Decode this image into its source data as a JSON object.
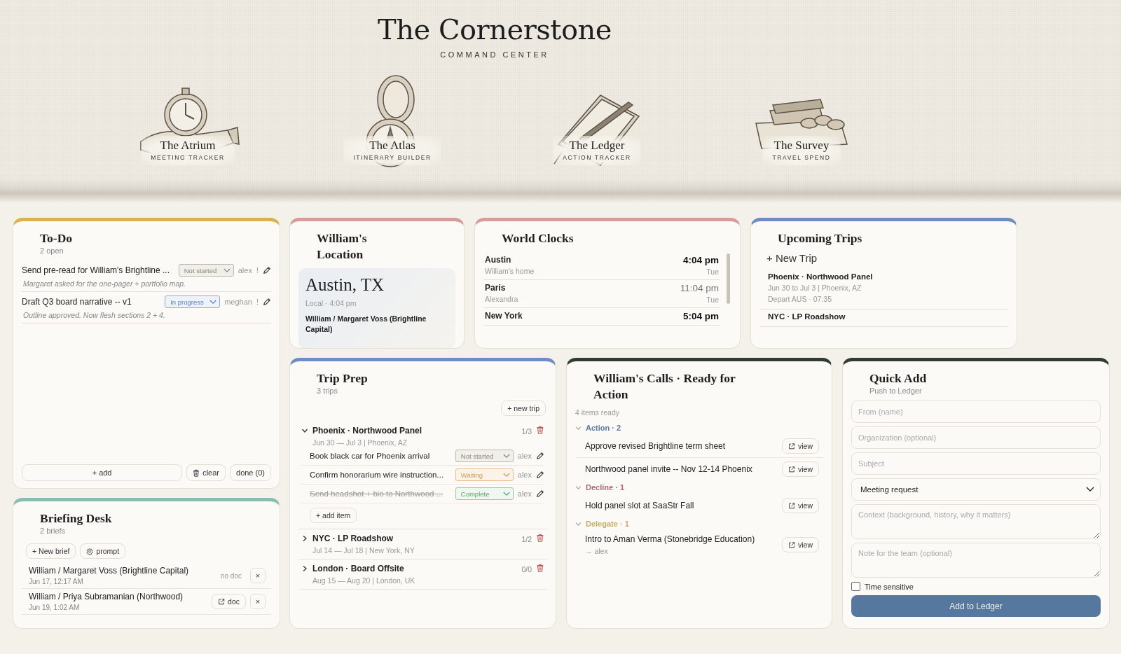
{
  "header": {
    "title": "The Cornerstone",
    "subtitle": "COMMAND CENTER"
  },
  "nav": [
    {
      "kind": "watch",
      "title": "The Atrium",
      "subtitle": "MEETING TRACKER"
    },
    {
      "kind": "compass",
      "title": "The Atlas",
      "subtitle": "ITINERARY BUILDER"
    },
    {
      "kind": "ledger",
      "title": "The Ledger",
      "subtitle": "ACTION TRACKER"
    },
    {
      "kind": "money",
      "title": "The Survey",
      "subtitle": "TRAVEL SPEND"
    }
  ],
  "todo": {
    "title": "To-Do",
    "count": "2 open",
    "items": [
      {
        "text": "Send pre-read for William's Brightline ...",
        "status": {
          "label": "Not started",
          "kind": "neutral"
        },
        "owner": "alex",
        "flag": "!",
        "note": "Margaret asked for the one-pager + portfolio map."
      },
      {
        "text": "Draft Q3 board narrative -- v1",
        "status": {
          "label": "In progress",
          "kind": "progress"
        },
        "owner": "meghan",
        "flag": "!",
        "note": "Outline approved. Now flesh sections 2 + 4."
      }
    ],
    "add": "+ add",
    "clear": "clear",
    "done": "done (0)"
  },
  "briefing": {
    "title": "Briefing Desk",
    "count": "2 briefs",
    "new": "+ New brief",
    "prompt": "prompt",
    "items": [
      {
        "title": "William / Margaret Voss (Brightline Capital)",
        "time": "Jun 17, 12:17 AM",
        "doc": {
          "kind": "none",
          "label": "no doc"
        },
        "close": "×"
      },
      {
        "title": "William / Priya Subramanian (Northwood)",
        "time": "Jun 19, 1:02 AM",
        "doc": {
          "kind": "link",
          "label": "doc"
        },
        "close": "×"
      }
    ]
  },
  "location": {
    "title": "William's Location",
    "city": "Austin, TX",
    "local": "Local · 4:04 pm",
    "meeting": "William / Margaret Voss (Brightline Capital)"
  },
  "clocks": {
    "title": "World Clocks",
    "items": [
      {
        "city": "Austin",
        "label": "William's home",
        "time": "4:04 pm",
        "day": "Tue",
        "dim": false
      },
      {
        "city": "Paris",
        "label": "Alexandra",
        "time": "11:04 pm",
        "day": "Tue",
        "dim": true
      },
      {
        "city": "New York",
        "time": "5:04 pm",
        "dim": false
      }
    ]
  },
  "trips": {
    "title": "Upcoming Trips",
    "new": "+ New Trip",
    "items": [
      {
        "name": "Phoenix · Northwood Panel",
        "dates": "Jun 30 to Jul 3 | Phoenix, AZ",
        "depart": "Depart AUS · 07:35"
      },
      {
        "name": "NYC · LP Roadshow"
      }
    ]
  },
  "trip_prep": {
    "title": "Trip Prep",
    "count": "3 trips",
    "new": "+ new trip",
    "add_item": "+ add item",
    "trips": [
      {
        "name": "Phoenix · Northwood Panel",
        "dates": "Jun 30 — Jul 3 | Phoenix, AZ",
        "progress": "1/3",
        "expanded": true,
        "items": [
          {
            "text": "Book black car for Phoenix arrival",
            "status": {
              "label": "Not started",
              "kind": "neutral"
            },
            "owner": "alex",
            "done": false
          },
          {
            "text": "Confirm honorarium wire instruction...",
            "status": {
              "label": "Waiting",
              "kind": "waiting"
            },
            "owner": "alex",
            "done": false
          },
          {
            "text": "Send headshot + bio to Northwood ...",
            "status": {
              "label": "Complete",
              "kind": "complete"
            },
            "owner": "alex",
            "done": true
          }
        ]
      },
      {
        "name": "NYC · LP Roadshow",
        "dates": "Jul 14 — Jul 18 | New York, NY",
        "progress": "1/2",
        "expanded": false
      },
      {
        "name": "London · Board Offsite",
        "dates": "Aug 15 — Aug 20 | London, UK",
        "progress": "0/0",
        "expanded": false
      }
    ]
  },
  "calls": {
    "title": "William's Calls · Ready for Action",
    "count": "4 items ready",
    "groups": [
      {
        "label": "Action · 2",
        "color": "#5b7aa6",
        "expanded": true,
        "items": [
          {
            "text": "Approve revised Brightline term sheet",
            "button": "view"
          },
          {
            "text": "Northwood panel invite -- Nov 12-14 Phoenix",
            "button": "view"
          }
        ]
      },
      {
        "label": "Decline · 1",
        "color": "#b5647a",
        "expanded": true,
        "items": [
          {
            "text": "Hold panel slot at SaaStr Fall",
            "button": "view"
          }
        ]
      },
      {
        "label": "Delegate · 1",
        "color": "#c4ad62",
        "expanded": true,
        "items": [
          {
            "text": "Intro to Aman Verma (Stonebridge Education)",
            "assignee": "→ alex",
            "button": "view"
          }
        ]
      }
    ]
  },
  "quick_add": {
    "title": "Quick Add",
    "subtitle": "Push to Ledger",
    "fields": [
      {
        "kind": "input",
        "placeholder": "From (name)"
      },
      {
        "kind": "input",
        "placeholder": "Organization (optional)"
      },
      {
        "kind": "input",
        "placeholder": "Subject"
      },
      {
        "kind": "select",
        "value": "Meeting request"
      },
      {
        "kind": "textarea",
        "placeholder": "Context (background, history, why it matters)"
      },
      {
        "kind": "textarea",
        "placeholder": "Note for the team (optional)"
      }
    ],
    "checkbox": {
      "label": "Time sensitive",
      "checked": false
    },
    "submit": "Add to Ledger"
  }
}
